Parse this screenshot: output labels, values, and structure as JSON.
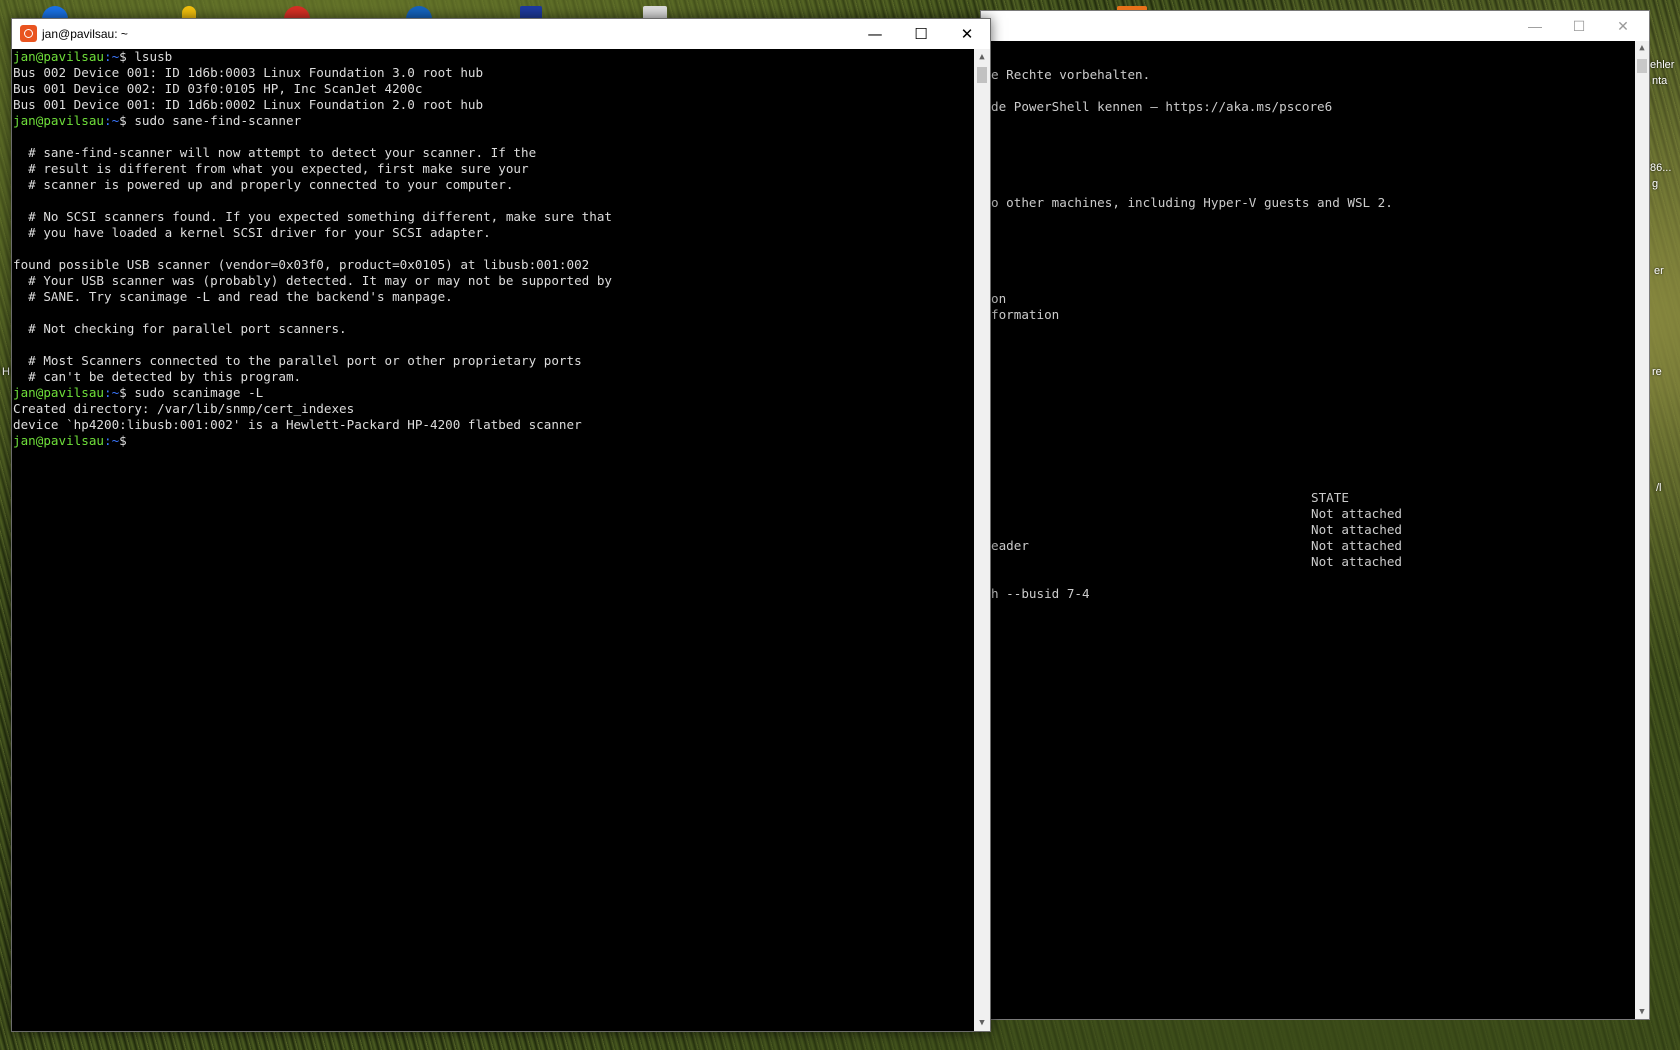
{
  "desktop": {
    "right_edge_labels": [
      "ehler",
      "nta",
      "86...",
      "g",
      "er",
      "re",
      "/l"
    ],
    "left_edge_label": "H"
  },
  "ps_window": {
    "controls": {
      "minimize": "—",
      "maximize": "☐",
      "close": "✕"
    },
    "lines": [
      "e Rechte vorbehalten.",
      "de PowerShell kennen – https://aka.ms/pscore6",
      "o other machines, including Hyper-V guests and WSL 2.",
      "on",
      "formation",
      "STATE",
      "Not attached",
      "Not attached",
      "eader",
      "Not attached",
      "Not attached",
      "h --busid 7-4"
    ]
  },
  "terminal": {
    "title": "jan@pavilsau: ~",
    "controls": {
      "minimize": "—",
      "maximize": "☐",
      "close": "✕"
    },
    "prompt": {
      "user": "jan@pavilsau",
      "path": ":~",
      "symbol": "$"
    },
    "lines": [
      {
        "type": "cmd",
        "text": " lsusb"
      },
      {
        "type": "out",
        "text": "Bus 002 Device 001: ID 1d6b:0003 Linux Foundation 3.0 root hub"
      },
      {
        "type": "out",
        "text": "Bus 001 Device 002: ID 03f0:0105 HP, Inc ScanJet 4200c"
      },
      {
        "type": "out",
        "text": "Bus 001 Device 001: ID 1d6b:0002 Linux Foundation 2.0 root hub"
      },
      {
        "type": "cmd",
        "text": " sudo sane-find-scanner"
      },
      {
        "type": "out",
        "text": ""
      },
      {
        "type": "out",
        "text": "  # sane-find-scanner will now attempt to detect your scanner. If the"
      },
      {
        "type": "out",
        "text": "  # result is different from what you expected, first make sure your"
      },
      {
        "type": "out",
        "text": "  # scanner is powered up and properly connected to your computer."
      },
      {
        "type": "out",
        "text": ""
      },
      {
        "type": "out",
        "text": "  # No SCSI scanners found. If you expected something different, make sure that"
      },
      {
        "type": "out",
        "text": "  # you have loaded a kernel SCSI driver for your SCSI adapter."
      },
      {
        "type": "out",
        "text": ""
      },
      {
        "type": "out",
        "text": "found possible USB scanner (vendor=0x03f0, product=0x0105) at libusb:001:002"
      },
      {
        "type": "out",
        "text": "  # Your USB scanner was (probably) detected. It may or may not be supported by"
      },
      {
        "type": "out",
        "text": "  # SANE. Try scanimage -L and read the backend's manpage."
      },
      {
        "type": "out",
        "text": ""
      },
      {
        "type": "out",
        "text": "  # Not checking for parallel port scanners."
      },
      {
        "type": "out",
        "text": ""
      },
      {
        "type": "out",
        "text": "  # Most Scanners connected to the parallel port or other proprietary ports"
      },
      {
        "type": "out",
        "text": "  # can't be detected by this program."
      },
      {
        "type": "cmd",
        "text": " sudo scanimage -L"
      },
      {
        "type": "out",
        "text": "Created directory: /var/lib/snmp/cert_indexes"
      },
      {
        "type": "out",
        "text": "device `hp4200:libusb:001:002' is a Hewlett-Packard HP-4200 flatbed scanner"
      },
      {
        "type": "cmd",
        "text": " "
      }
    ]
  }
}
